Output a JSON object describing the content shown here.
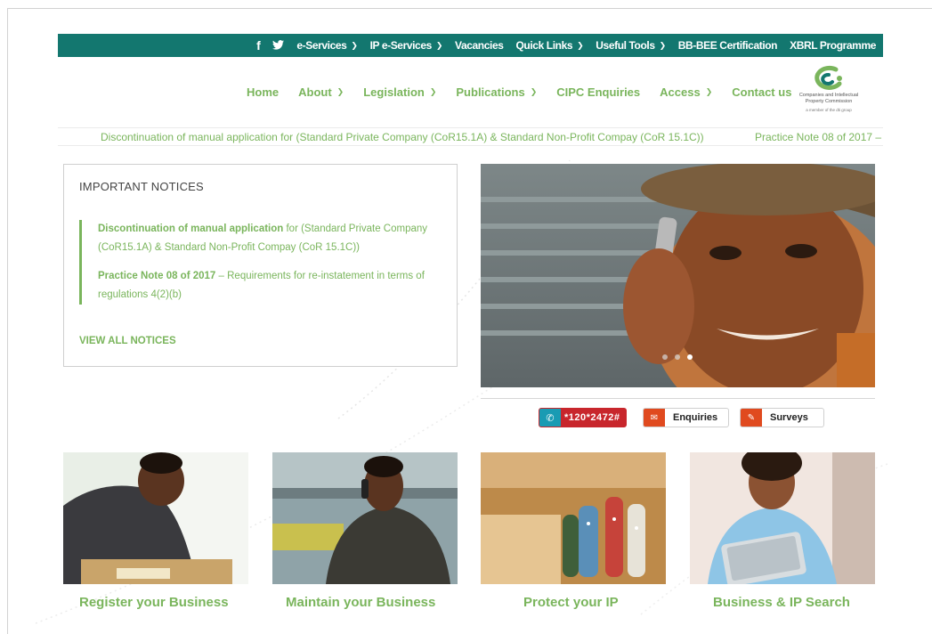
{
  "topbar": {
    "social": [
      {
        "name": "facebook-icon",
        "glyph": "f"
      },
      {
        "name": "twitter-icon",
        "glyph": "🐦"
      }
    ],
    "items": [
      {
        "label": "e-Services",
        "dropdown": true
      },
      {
        "label": "IP e-Services",
        "dropdown": true
      },
      {
        "label": "Vacancies",
        "dropdown": false
      },
      {
        "label": "Quick Links",
        "dropdown": true
      },
      {
        "label": "Useful Tools",
        "dropdown": true
      },
      {
        "label": "BB-BEE Certification",
        "dropdown": false
      },
      {
        "label": "XBRL Programme",
        "dropdown": false
      }
    ]
  },
  "nav": {
    "items": [
      {
        "label": "Home",
        "dropdown": false
      },
      {
        "label": "About",
        "dropdown": true
      },
      {
        "label": "Legislation",
        "dropdown": true
      },
      {
        "label": "Publications",
        "dropdown": true
      },
      {
        "label": "CIPC Enquiries",
        "dropdown": false
      },
      {
        "label": "Access",
        "dropdown": true
      },
      {
        "label": "Contact us",
        "dropdown": false
      }
    ]
  },
  "logo": {
    "line1": "Companies and Intellectual",
    "line2": "Property Commission",
    "line3": "a member of the dti group"
  },
  "ticker": {
    "item1": "Discontinuation of manual application for (Standard Private Company (CoR15.1A) & Standard Non-Profit Compay (CoR 15.1C))",
    "item2": "Practice Note 08 of 2017 –"
  },
  "notices": {
    "title": "IMPORTANT NOTICES",
    "n1_bold": "Discontinuation of manual application",
    "n1_rest": " for (Standard Private Company (CoR15.1A) & Standard Non-Profit Compay (CoR 15.1C))",
    "n2_bold": "Practice Note 08 of 2017",
    "n2_rest": " – Requirements for re-instatement in terms of regulations 4(2)(b)",
    "view_all": "VIEW ALL NOTICES"
  },
  "badges": {
    "call": "*120*2472#",
    "enquiries": "Enquiries",
    "surveys": "Surveys"
  },
  "cards": [
    {
      "label": "Register your Business"
    },
    {
      "label": "Maintain your Business"
    },
    {
      "label": "Protect your IP"
    },
    {
      "label": "Business & IP Search"
    }
  ],
  "colors": {
    "teal": "#13776f",
    "green": "#7ab55c",
    "red": "#c8262c",
    "orange": "#e04a1f"
  }
}
